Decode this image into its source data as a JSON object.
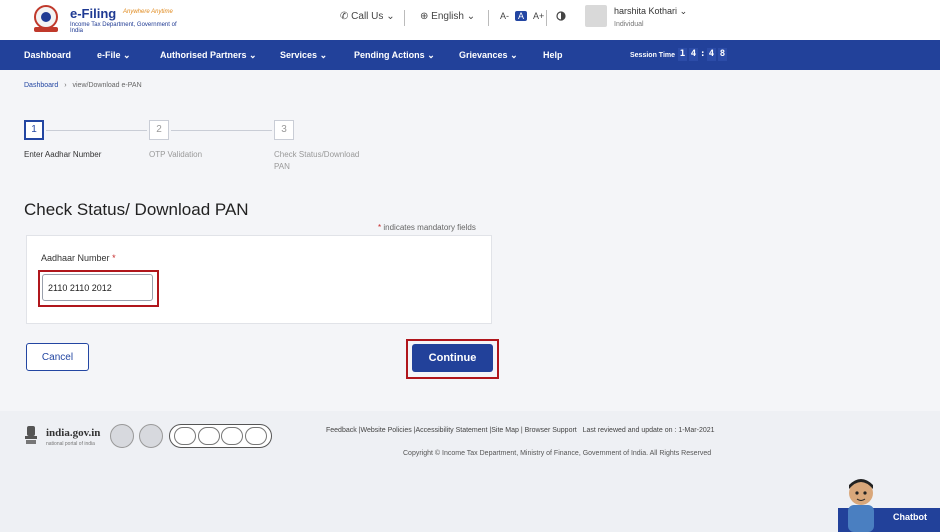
{
  "header": {
    "brand": "e-Filing",
    "brand_tagline": "Anywhere Anytime",
    "brand_subtitle": "Income Tax Department, Government of India",
    "call_us": "Call Us",
    "language": "English",
    "font_small": "A-",
    "font_normal": "A",
    "font_large": "A+",
    "user_name": "harshita Kothari",
    "user_role": "Individual"
  },
  "nav": {
    "items": [
      {
        "label": "Dashboard"
      },
      {
        "label": "e-File"
      },
      {
        "label": "Authorised Partners"
      },
      {
        "label": "Services"
      },
      {
        "label": "Pending Actions"
      },
      {
        "label": "Grievances"
      },
      {
        "label": "Help"
      }
    ],
    "session_label": "Session Time",
    "session_digits": [
      "1",
      "4",
      ":",
      "4",
      "8"
    ]
  },
  "breadcrumb": {
    "home": "Dashboard",
    "separator": "›",
    "current": "view/Download e-PAN"
  },
  "stepper": {
    "steps": [
      {
        "number": "1",
        "label": "Enter Aadhar Number"
      },
      {
        "number": "2",
        "label": "OTP Validation"
      },
      {
        "number": "3",
        "label": "Check Status/Download PAN"
      }
    ],
    "active_step": 1
  },
  "form": {
    "title": "Check Status/ Download PAN",
    "mandatory_note": "indicates mandatory fields",
    "field_label": "Aadhaar Number",
    "field_value": "2110 2110 2012",
    "cancel_label": "Cancel",
    "continue_label": "Continue"
  },
  "footer": {
    "india_gov": "india.gov.in",
    "india_gov_sub": "national portal of india",
    "links": [
      "Feedback",
      "Website Policies",
      "Accessibility Statement",
      "Site Map",
      "Browser Support"
    ],
    "last_reviewed": "Last reviewed and update on : 1-Mar-2021",
    "copyright": "Copyright © Income Tax Department, Ministry of Finance, Government of India. All Rights Reserved"
  },
  "chatbot": {
    "label": "Chatbot"
  },
  "colors": {
    "primary": "#22419a",
    "highlight": "#b0161c",
    "background": "#f4f5f8"
  }
}
